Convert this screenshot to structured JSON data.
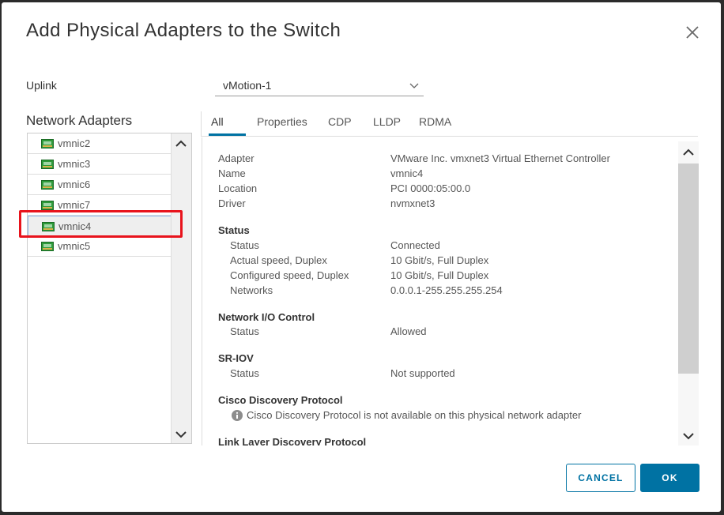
{
  "dialog": {
    "title": "Add Physical Adapters to the Switch",
    "uplink_label": "Uplink",
    "uplink_value": "vMotion-1"
  },
  "adapters": {
    "header": "Network Adapters",
    "items": [
      {
        "label": "vmnic2"
      },
      {
        "label": "vmnic3"
      },
      {
        "label": "vmnic6"
      },
      {
        "label": "vmnic7"
      },
      {
        "label": "vmnic4",
        "selected": true
      },
      {
        "label": "vmnic5"
      }
    ]
  },
  "tabs": [
    "All",
    "Properties",
    "CDP",
    "LLDP",
    "RDMA"
  ],
  "details": {
    "adapter_label": "Adapter",
    "adapter_value": "VMware Inc. vmxnet3 Virtual Ethernet Controller",
    "name_label": "Name",
    "name_value": "vmnic4",
    "location_label": "Location",
    "location_value": "PCI 0000:05:00.0",
    "driver_label": "Driver",
    "driver_value": "nvmxnet3",
    "status_header": "Status",
    "status_label": "Status",
    "status_value": "Connected",
    "actual_speed_label": "Actual speed, Duplex",
    "actual_speed_value": "10 Gbit/s, Full Duplex",
    "configured_speed_label": "Configured speed, Duplex",
    "configured_speed_value": "10 Gbit/s, Full Duplex",
    "networks_label": "Networks",
    "networks_value": "0.0.0.1-255.255.255.254",
    "nioc_header": "Network I/O Control",
    "nioc_status_label": "Status",
    "nioc_status_value": "Allowed",
    "sriov_header": "SR-IOV",
    "sriov_status_label": "Status",
    "sriov_status_value": "Not supported",
    "cdp_header": "Cisco Discovery Protocol",
    "cdp_message": "Cisco Discovery Protocol is not available on this physical network adapter",
    "lldp_header": "Link Layer Discovery Protocol"
  },
  "buttons": {
    "cancel": "CANCEL",
    "ok": "OK"
  },
  "icons": {
    "close": "close-icon",
    "dropdown": "chevron-down-icon",
    "nic": "network-adapter-icon",
    "info": "info-icon",
    "scroll_up": "chevron-up-icon",
    "scroll_down": "chevron-down-icon"
  },
  "colors": {
    "accent": "#0072a3",
    "highlight": "#e8131c",
    "nic_icon": "#2e9a3a"
  }
}
